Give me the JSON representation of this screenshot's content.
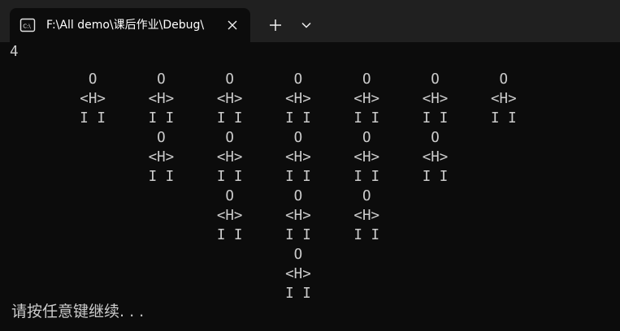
{
  "window": {
    "tab_title": "F:\\All demo\\课后作业\\Debug\\",
    "tab_icon": "console-app-icon",
    "close_icon": "close-icon",
    "new_tab_icon": "plus-icon",
    "dropdown_icon": "chevron-down-icon"
  },
  "console": {
    "lines": [
      "4",
      "         O       O       O       O       O       O       O",
      "        <H>     <H>     <H>     <H>     <H>     <H>     <H>",
      "        I I     I I     I I     I I     I I     I I     I I",
      "                 O       O       O       O       O",
      "                <H>     <H>     <H>     <H>     <H>",
      "                I I     I I     I I     I I     I I",
      "                         O       O       O",
      "                        <H>     <H>     <H>",
      "                        I I     I I     I I",
      "                                 O",
      "                                <H>",
      "                                I I"
    ],
    "prompt": "请按任意键继续. . ."
  },
  "colors": {
    "background": "#0c0c0c",
    "tabbar": "#202020",
    "text": "#cccccc"
  }
}
